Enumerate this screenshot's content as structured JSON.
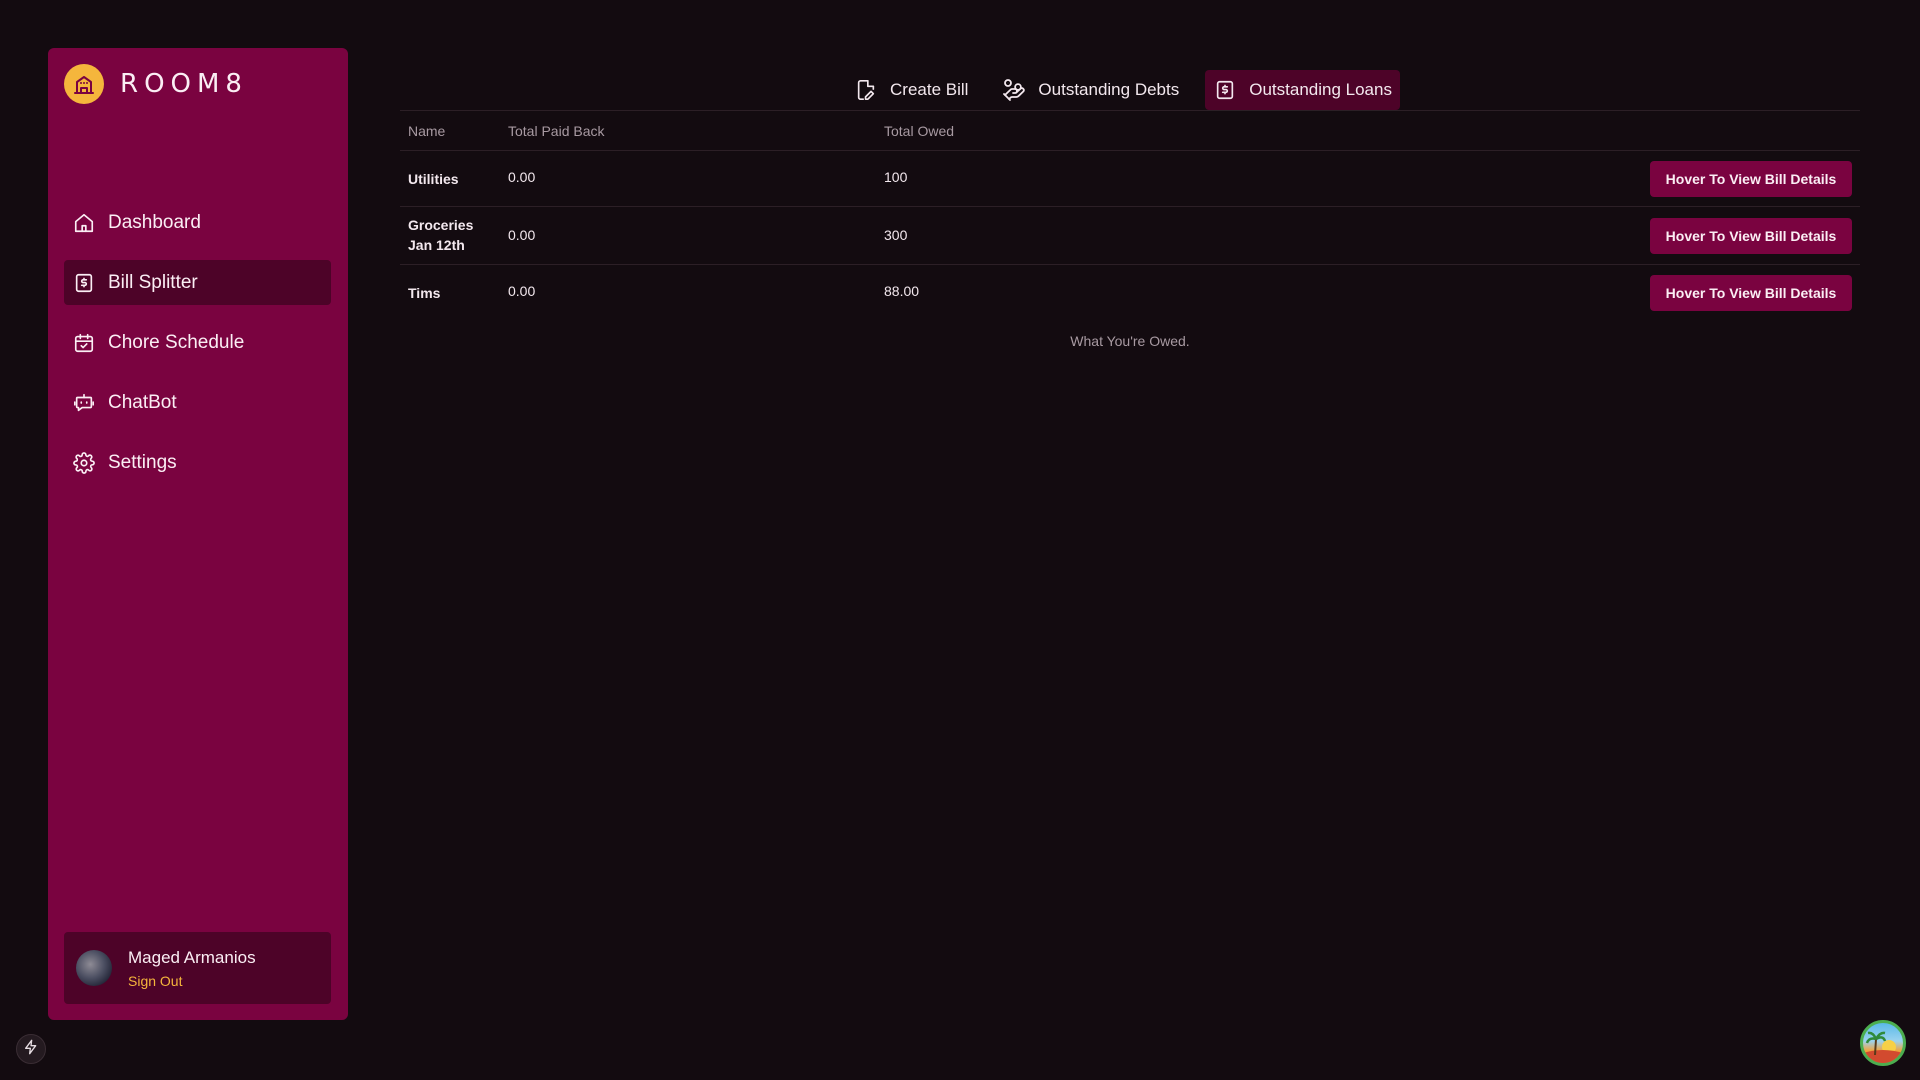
{
  "app": {
    "name": "ROOM8"
  },
  "sidebar": {
    "items": [
      {
        "label": "Dashboard",
        "icon": "home-icon",
        "active": false
      },
      {
        "label": "Bill Splitter",
        "icon": "dollar-receipt-icon",
        "active": true
      },
      {
        "label": "Chore Schedule",
        "icon": "calendar-check-icon",
        "active": false
      },
      {
        "label": "ChatBot",
        "icon": "robot-icon",
        "active": false
      },
      {
        "label": "Settings",
        "icon": "gear-icon",
        "active": false
      }
    ],
    "user": {
      "name": "Maged Armanios",
      "sign_out": "Sign Out"
    }
  },
  "tabs": [
    {
      "label": "Create Bill",
      "icon": "file-edit-icon",
      "active": false
    },
    {
      "label": "Outstanding Debts",
      "icon": "hand-coins-icon",
      "active": false
    },
    {
      "label": "Outstanding Loans",
      "icon": "dollar-receipt-icon",
      "active": true
    }
  ],
  "table": {
    "headers": {
      "name": "Name",
      "paid": "Total Paid Back",
      "owed": "Total Owed"
    },
    "rows": [
      {
        "name": "Utilities",
        "paid": "0.00",
        "owed": "100",
        "action": "Hover To View Bill Details"
      },
      {
        "name": "Groceries Jan 12th",
        "paid": "0.00",
        "owed": "300",
        "action": "Hover To View Bill Details"
      },
      {
        "name": "Tims",
        "paid": "0.00",
        "owed": "88.00",
        "action": "Hover To View Bill Details"
      }
    ],
    "caption": "What You're Owed."
  },
  "colors": {
    "background": "#130b10",
    "sidebar": "#7a0340",
    "active": "#4d0328",
    "accent": "#f5b63c"
  }
}
